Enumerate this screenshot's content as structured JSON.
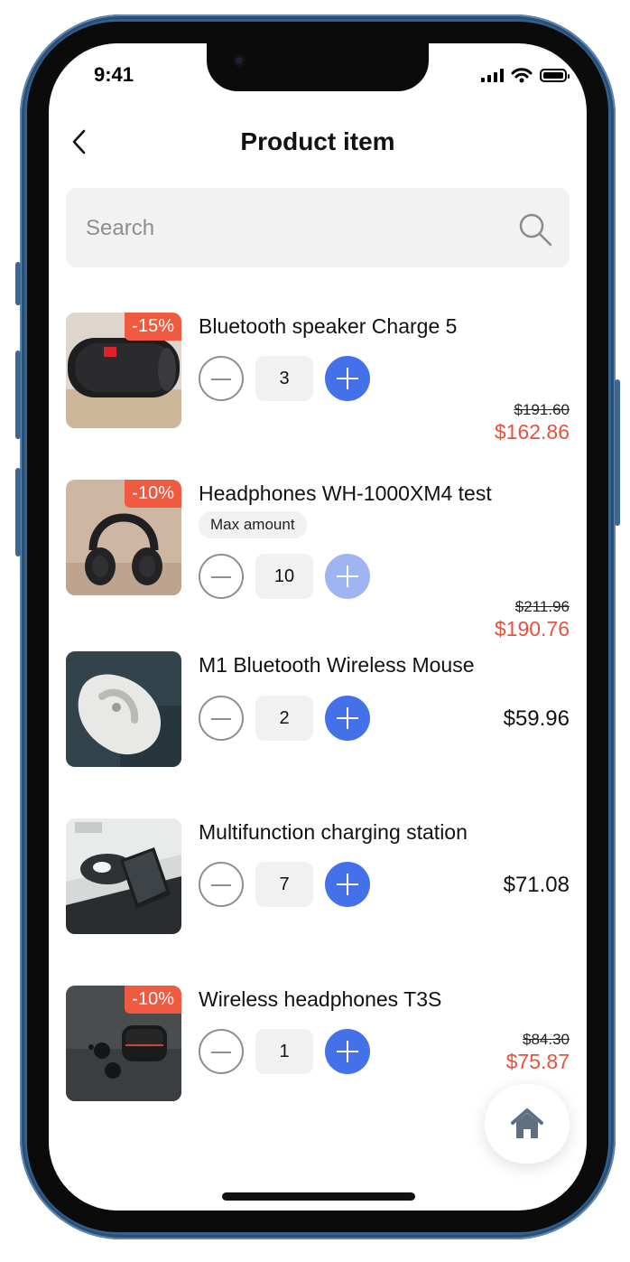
{
  "status_bar": {
    "time": "9:41"
  },
  "header": {
    "title": "Product item"
  },
  "search": {
    "placeholder": "Search"
  },
  "products": [
    {
      "name": "Bluetooth speaker Charge 5",
      "discount": "-15%",
      "quantity": "3",
      "old_price": "$191.60",
      "price": "$162.86"
    },
    {
      "name": "Headphones WH-1000XM4 test",
      "discount": "-10%",
      "badge": "Max amount",
      "quantity": "10",
      "old_price": "$211.96",
      "price": "$190.76"
    },
    {
      "name": "M1 Bluetooth Wireless Mouse",
      "quantity": "2",
      "price": "$59.96"
    },
    {
      "name": "Multifunction charging station",
      "quantity": "7",
      "price": "$71.08"
    },
    {
      "name": "Wireless headphones T3S",
      "discount": "-10%",
      "quantity": "1",
      "old_price": "$84.30",
      "price": "$75.87"
    }
  ],
  "colors": {
    "accent": "#4471e8",
    "accent_disabled": "#9fb5f2",
    "discount": "#ef5a41",
    "sale_price": "#e5533d",
    "frame": "#35618f"
  },
  "icons": {
    "back": "chevron-left-icon",
    "search": "search-icon",
    "home": "home-icon"
  }
}
